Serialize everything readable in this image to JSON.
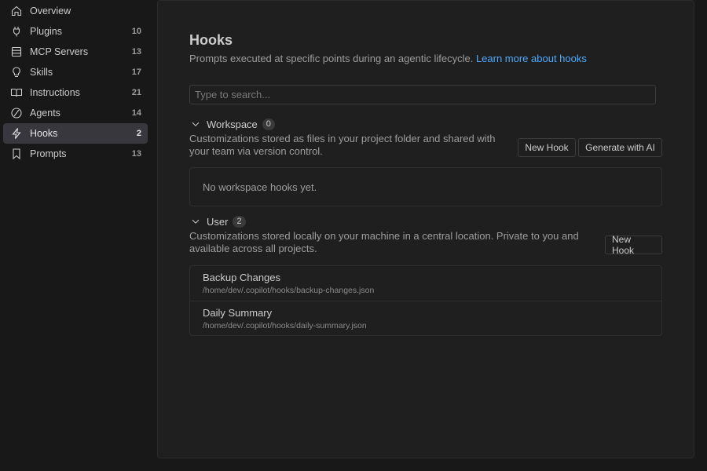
{
  "sidebar": {
    "items": [
      {
        "label": "Overview",
        "count": "",
        "icon": "home-icon"
      },
      {
        "label": "Plugins",
        "count": "10",
        "icon": "plug-icon"
      },
      {
        "label": "MCP Servers",
        "count": "13",
        "icon": "server-icon"
      },
      {
        "label": "Skills",
        "count": "17",
        "icon": "lightbulb-icon"
      },
      {
        "label": "Instructions",
        "count": "21",
        "icon": "book-icon"
      },
      {
        "label": "Agents",
        "count": "14",
        "icon": "agent-icon"
      },
      {
        "label": "Hooks",
        "count": "2",
        "icon": "lightning-icon",
        "active": true
      },
      {
        "label": "Prompts",
        "count": "13",
        "icon": "bookmark-icon"
      }
    ]
  },
  "main": {
    "title": "Hooks",
    "subtitle": "Prompts executed at specific points during an agentic lifecycle.",
    "learn_more": "Learn more about hooks",
    "search_placeholder": "Type to search...",
    "workspace": {
      "title": "Workspace",
      "count": "0",
      "description": "Customizations stored as files in your project folder and shared with your team via version control.",
      "new_hook_label": "New Hook",
      "generate_label": "Generate with AI",
      "empty_text": "No workspace hooks yet."
    },
    "user": {
      "title": "User",
      "count": "2",
      "description": "Customizations stored locally on your machine in a central location. Private to you and available across all projects.",
      "new_hook_label": "New Hook",
      "items": [
        {
          "name": "Backup Changes",
          "path": "/home/dev/.copilot/hooks/backup-changes.json"
        },
        {
          "name": "Daily Summary",
          "path": "/home/dev/.copilot/hooks/daily-summary.json"
        }
      ]
    }
  },
  "colors": {
    "accent_link": "#4daafc",
    "active_bg": "#37373d",
    "panel_bg": "#1f1f1f",
    "page_bg": "#181818"
  }
}
